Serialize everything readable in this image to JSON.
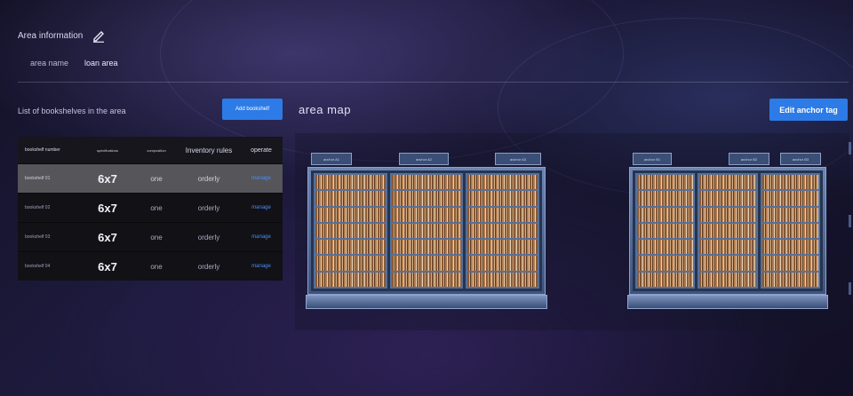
{
  "area_info": {
    "title": "Area information",
    "name_label": "area name",
    "name_value": "loan area"
  },
  "list": {
    "title": "List of bookshelves in the area",
    "add_button": "Add bookshelf",
    "columns": [
      "bookshelf number",
      "specifications",
      "composition",
      "Inventory rules",
      "operate"
    ],
    "rows": [
      {
        "number": "bookshelf 01",
        "spec": "6x7",
        "composition": "one",
        "rule": "orderly",
        "action": "manage"
      },
      {
        "number": "bookshelf 02",
        "spec": "6x7",
        "composition": "one",
        "rule": "orderly",
        "action": "manage"
      },
      {
        "number": "bookshelf 03",
        "spec": "6x7",
        "composition": "one",
        "rule": "orderly",
        "action": "manage"
      },
      {
        "number": "bookshelf 04",
        "spec": "6x7",
        "composition": "one",
        "rule": "orderly",
        "action": "manage"
      }
    ]
  },
  "map": {
    "title": "area map",
    "edit_button": "Edit anchor tag",
    "tags_left": [
      "anchor A1",
      "anchor A2",
      "anchor A3"
    ],
    "tags_right": [
      "anchor B1",
      "anchor B2",
      "anchor B3"
    ]
  },
  "colors": {
    "accent": "#2d7be6",
    "link": "#4d8ef0",
    "selected_row": "#55555a"
  }
}
